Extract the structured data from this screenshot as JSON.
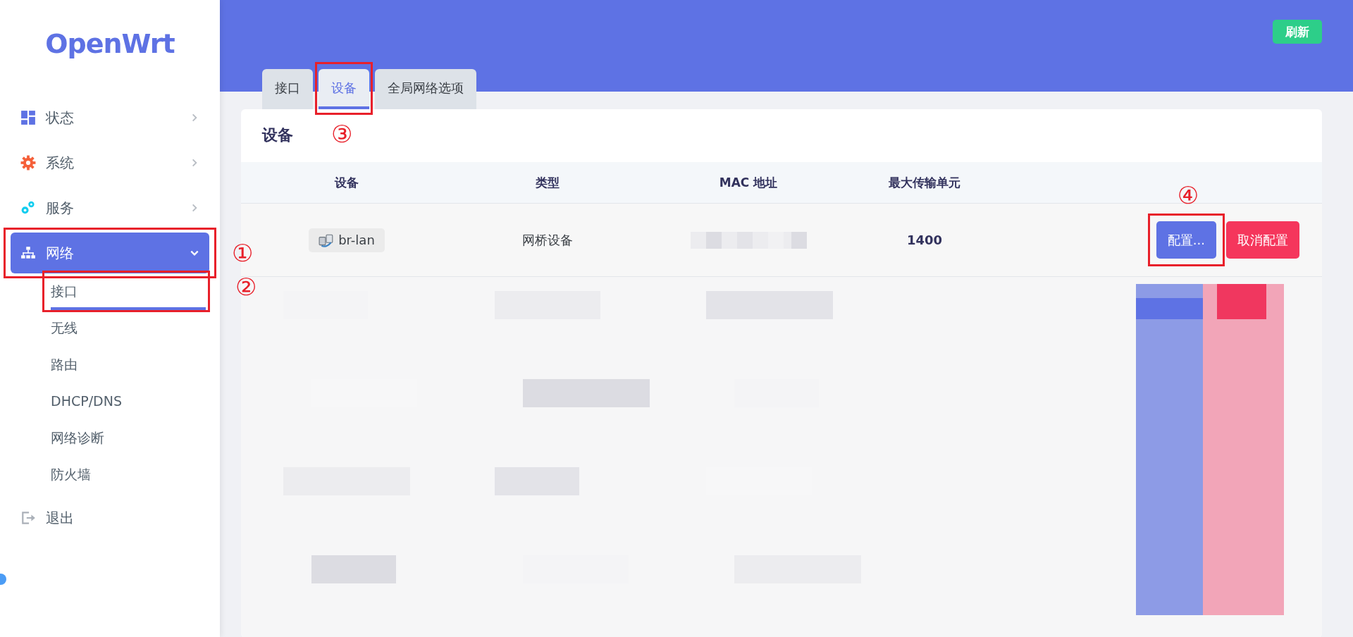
{
  "sidebar": {
    "logo": "OpenWrt",
    "menu": [
      {
        "label": "状态",
        "kind": "dashboard",
        "selected": false,
        "expanded": false
      },
      {
        "label": "系统",
        "kind": "gear",
        "selected": false,
        "expanded": false
      },
      {
        "label": "服务",
        "kind": "gears",
        "selected": false,
        "expanded": false
      },
      {
        "label": "网络",
        "kind": "sitemap",
        "selected": true,
        "expanded": true,
        "annotation": "①",
        "children": [
          {
            "label": "接口",
            "selected": true,
            "annotation": "②"
          },
          {
            "label": "无线",
            "selected": false
          },
          {
            "label": "路由",
            "selected": false
          },
          {
            "label": "DHCP/DNS",
            "selected": false
          },
          {
            "label": "网络诊断",
            "selected": false
          },
          {
            "label": "防火墙",
            "selected": false
          }
        ]
      },
      {
        "label": "退出",
        "kind": "logout",
        "selected": false
      }
    ]
  },
  "header": {
    "refresh_button": "刷新"
  },
  "tabs": [
    {
      "label": "接口",
      "selected": false
    },
    {
      "label": "设备",
      "selected": true,
      "annotation": "③"
    },
    {
      "label": "全局网络选项",
      "selected": false
    }
  ],
  "section": {
    "title": "设备",
    "table": {
      "columns": [
        "设备",
        "类型",
        "MAC 地址",
        "最大传输单元"
      ],
      "rows": [
        {
          "device": "br-lan",
          "type": "网桥设备",
          "mtu": "1400",
          "buttons": [
            {
              "label": "配置...",
              "kind": "primary",
              "annotation": "④"
            },
            {
              "label": "取消配置",
              "kind": "danger"
            }
          ]
        }
      ]
    }
  }
}
